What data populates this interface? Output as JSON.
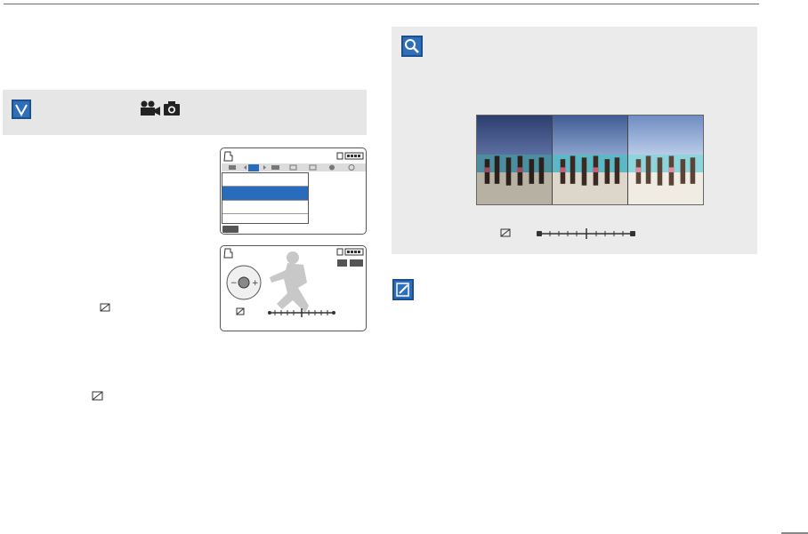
{
  "header": {
    "rule": true
  },
  "left_section": {
    "mode_icons": [
      "video-camera-icon",
      "camera-icon"
    ],
    "check_icon": "check-icon"
  },
  "lcd_menu": {
    "tab_icons": [
      "resolution-icon",
      "exposure-icon",
      "screen-icon",
      "focus-icon",
      "frame-icon",
      "timer-icon",
      "smile-icon"
    ],
    "selected_row": 2,
    "menu_button_icon": "menu-icon"
  },
  "lcd_adjust": {
    "exposure_level": 0.6
  },
  "right_panel": {
    "search_icon": "magnifier-icon",
    "exposure_scale_level": 0.5,
    "photos": [
      "dark",
      "normal",
      "bright"
    ]
  },
  "note": {
    "icon": "pencil-note-icon"
  },
  "colors": {
    "accent": "#2f6fba",
    "panel_bg": "#ebebeb",
    "band_bg": "#e6e6e6"
  }
}
